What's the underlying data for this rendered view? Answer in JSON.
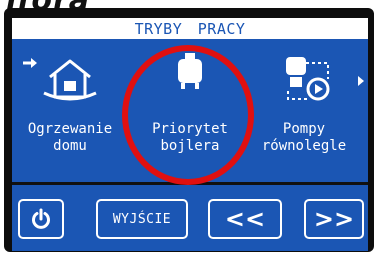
{
  "heading": "ifora",
  "screen": {
    "title": "TRYBY PRACY",
    "modes": [
      {
        "label": "Ogrzewanie\ndomu",
        "icon": "house-heating-icon"
      },
      {
        "label": "Priorytet\nbojlera",
        "icon": "boiler-icon"
      },
      {
        "label": "Pompy\nrównolegle",
        "icon": "parallel-pumps-icon"
      }
    ],
    "nav_arrows": {
      "left": "arrow-right-icon",
      "right": "arrow-right-small-icon"
    }
  },
  "buttons": {
    "power": "power-icon",
    "exit": "WYJŚCIE",
    "prev": "<<",
    "next": ">>"
  },
  "colors": {
    "screen_blue": "#1b56b4",
    "frame": "#0d0d0d",
    "highlight_red": "#e01010"
  }
}
